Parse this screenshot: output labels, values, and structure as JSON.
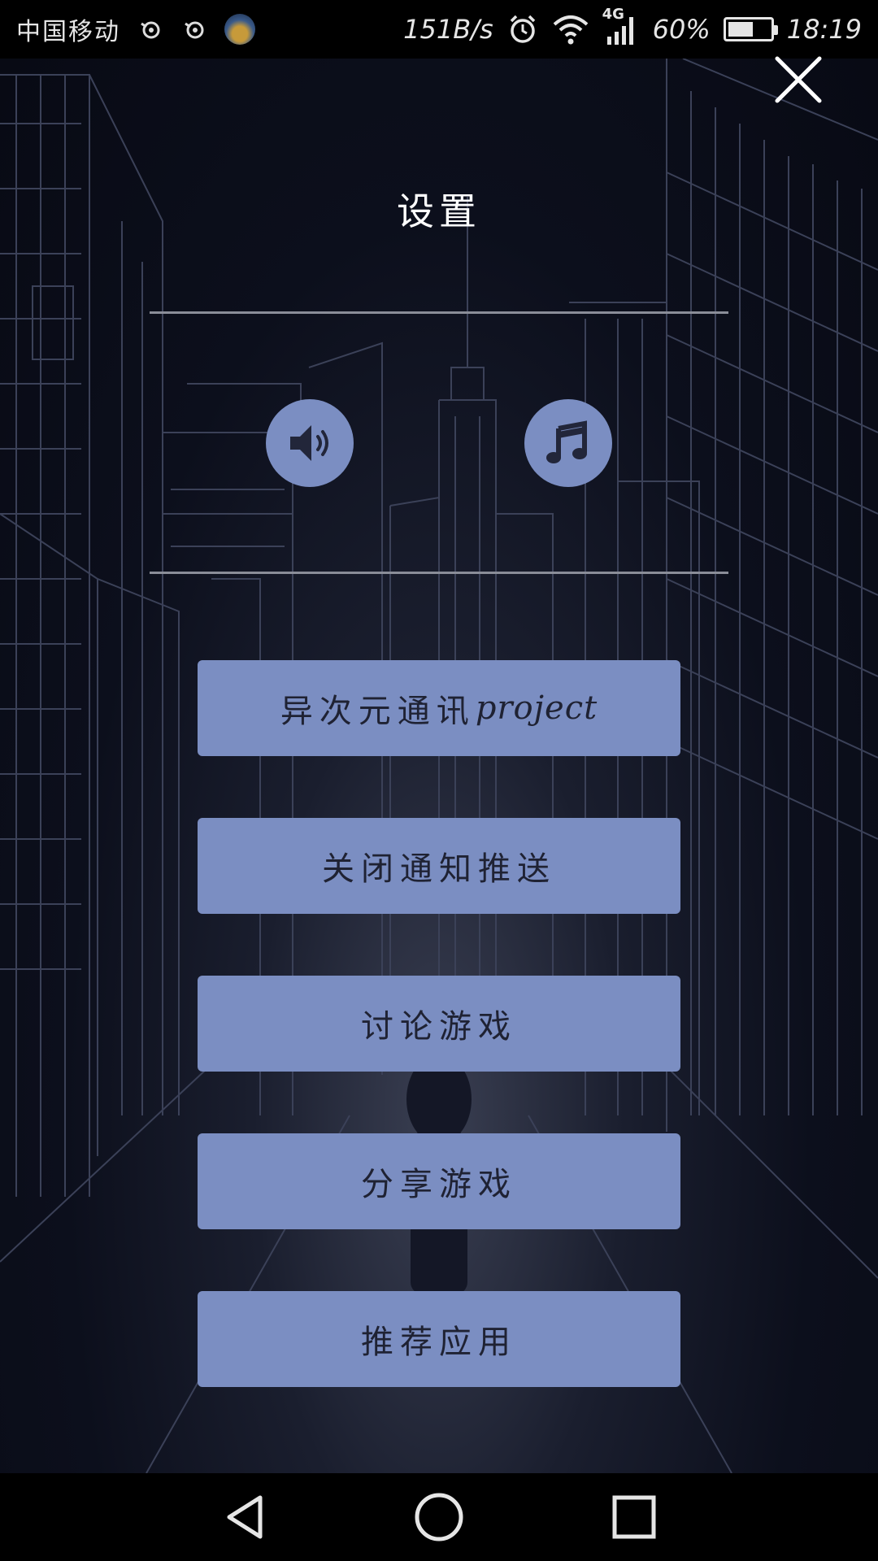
{
  "status_bar": {
    "carrier": "中国移动",
    "net_speed": "151B/s",
    "network_type": "4G",
    "battery_percent": "60%",
    "battery_level": 0.6,
    "time": "18:19"
  },
  "settings": {
    "title": "设置",
    "sound_icon": "speaker-icon",
    "music_icon": "music-note-icon",
    "accent_color": "#7b8ec2",
    "buttons": [
      {
        "label_prefix": "异次元通讯",
        "label_suffix": "project"
      },
      {
        "label": "关闭通知推送"
      },
      {
        "label": "讨论游戏"
      },
      {
        "label": "分享游戏"
      },
      {
        "label": "推荐应用"
      }
    ]
  },
  "nav_bar": {
    "back_icon": "back-triangle-icon",
    "home_icon": "home-circle-icon",
    "recents_icon": "recents-square-icon"
  }
}
